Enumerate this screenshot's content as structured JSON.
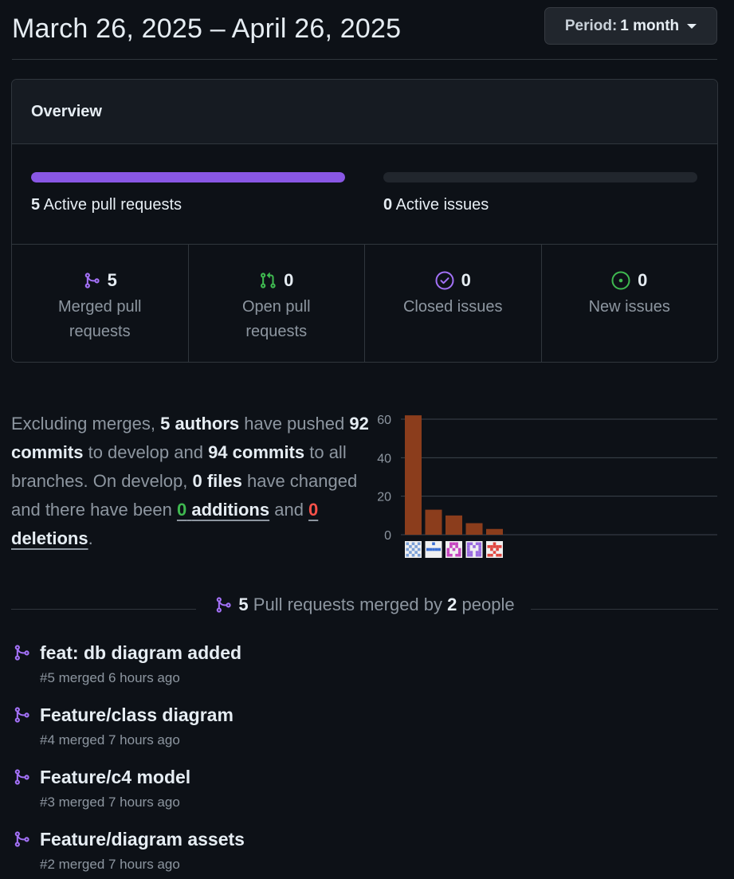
{
  "header": {
    "title": "March 26, 2025 – April 26, 2025",
    "period_label": "Period:",
    "period_value": "1 month"
  },
  "overview": {
    "title": "Overview",
    "active_prs": {
      "count": "5",
      "label": "Active pull requests",
      "fill_fraction": 1.0
    },
    "active_issues": {
      "count": "0",
      "label": "Active issues",
      "fill_fraction": 0.0
    },
    "stats": [
      {
        "icon": "merged-pr-icon",
        "value": "5",
        "label": "Merged pull requests",
        "color": "#a371f7"
      },
      {
        "icon": "open-pr-icon",
        "value": "0",
        "label": "Open pull requests",
        "color": "#3fb950"
      },
      {
        "icon": "closed-issue-icon",
        "value": "0",
        "label": "Closed issues",
        "color": "#a371f7"
      },
      {
        "icon": "new-issue-icon",
        "value": "0",
        "label": "New issues",
        "color": "#3fb950"
      }
    ]
  },
  "summary": {
    "t1": "Excluding merges, ",
    "authors": "5 authors",
    "t2": " have pushed ",
    "commits_develop": "92 commits",
    "t3": " to develop and ",
    "commits_all": "94 commits",
    "t4": " to all branches. On develop, ",
    "files": "0 files",
    "t5": " have changed and there have been ",
    "additions_count": "0",
    "additions_label": "additions",
    "t6": " and ",
    "deletions_count": "0",
    "deletions_label": "deletions",
    "t7": "."
  },
  "chart_data": {
    "type": "bar",
    "categories": [
      "author 1",
      "author 2",
      "author 3",
      "author 4",
      "author 5"
    ],
    "values": [
      62,
      13,
      10,
      6,
      3
    ],
    "yticks": [
      0,
      20,
      40,
      60
    ],
    "ylim": [
      0,
      60
    ],
    "bar_color": "#8b3d1c",
    "grid": true,
    "avatar_colors": [
      "#7aa0d8",
      "#3b6fd4",
      "#c645c0",
      "#9a6be0",
      "#e0463f"
    ]
  },
  "pull_requests": {
    "count": "5",
    "text_mid": "Pull requests merged by",
    "people": "2",
    "text_end": "people",
    "items": [
      {
        "title": "feat: db diagram added",
        "meta": "#5 merged 6 hours ago"
      },
      {
        "title": "Feature/class diagram",
        "meta": "#4 merged 7 hours ago"
      },
      {
        "title": "Feature/c4 model",
        "meta": "#3 merged 7 hours ago"
      },
      {
        "title": "Feature/diagram assets",
        "meta": "#2 merged 7 hours ago"
      }
    ]
  }
}
